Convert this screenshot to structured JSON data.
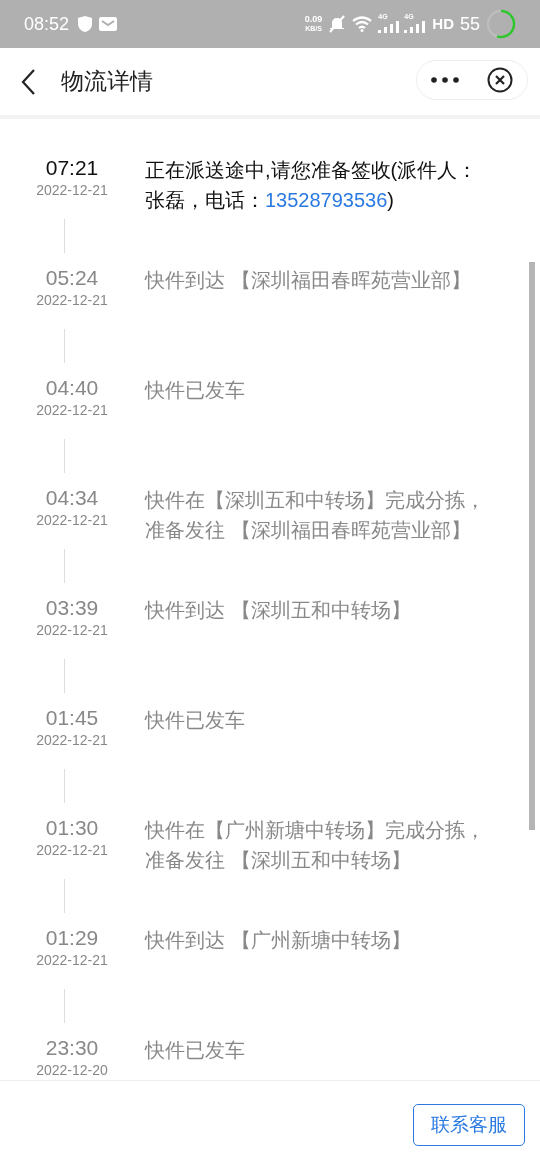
{
  "status_bar": {
    "time": "08:52",
    "net_speed_value": "0.09",
    "net_speed_unit": "KB/S",
    "signal_labels": [
      "4G",
      "4G"
    ],
    "hd": "HD",
    "battery": {
      "percent": "55"
    }
  },
  "header": {
    "title": "物流详情"
  },
  "entries": [
    {
      "time": "07:21",
      "date": "2022-12-21",
      "current": true,
      "text": "正在派送途中,请您准备签收(派件人：张磊，电话：",
      "phone": "13528793536",
      "text_after": ")"
    },
    {
      "time": "05:24",
      "date": "2022-12-21",
      "current": false,
      "text": "快件到达 【深圳福田春晖苑营业部】"
    },
    {
      "time": "04:40",
      "date": "2022-12-21",
      "current": false,
      "text": "快件已发车"
    },
    {
      "time": "04:34",
      "date": "2022-12-21",
      "current": false,
      "text": "快件在【深圳五和中转场】完成分拣，准备发往 【深圳福田春晖苑营业部】"
    },
    {
      "time": "03:39",
      "date": "2022-12-21",
      "current": false,
      "text": "快件到达 【深圳五和中转场】"
    },
    {
      "time": "01:45",
      "date": "2022-12-21",
      "current": false,
      "text": "快件已发车"
    },
    {
      "time": "01:30",
      "date": "2022-12-21",
      "current": false,
      "text": "快件在【广州新塘中转场】完成分拣，准备发往 【深圳五和中转场】"
    },
    {
      "time": "01:29",
      "date": "2022-12-21",
      "current": false,
      "text": "快件到达 【广州新塘中转场】"
    },
    {
      "time": "23:30",
      "date": "2022-12-20",
      "current": false,
      "text": "快件已发车"
    }
  ],
  "footer": {
    "button": "联系客服"
  }
}
